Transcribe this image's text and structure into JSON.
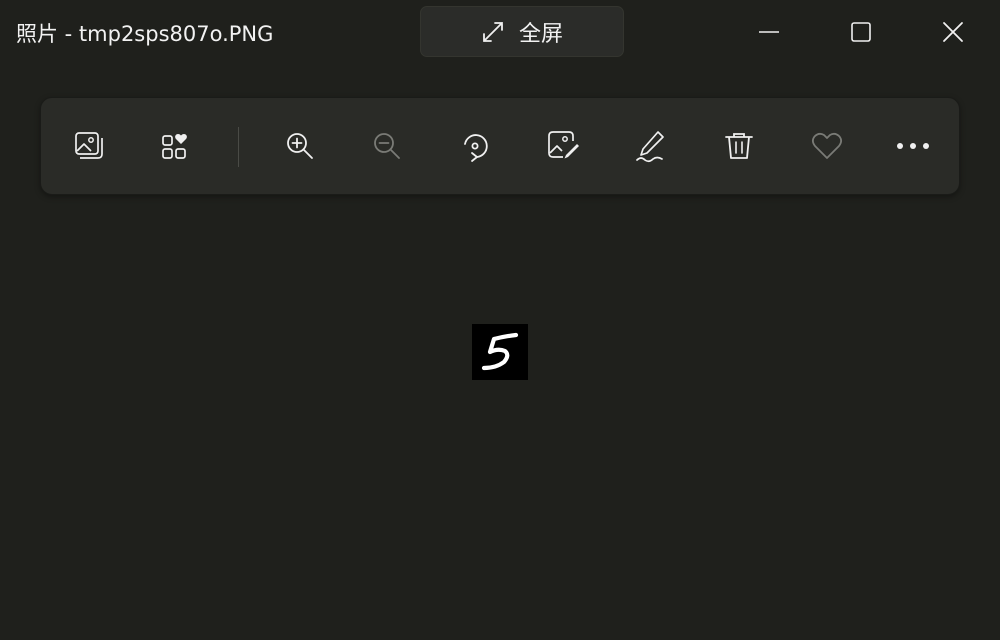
{
  "window": {
    "title": "照片 - tmp2sps807o.PNG"
  },
  "titlebar": {
    "fullscreen_label": "全屏",
    "fullscreen_icon": "expand-diagonal-icon",
    "controls": {
      "minimize_icon": "minimize-icon",
      "maximize_icon": "maximize-icon",
      "close_icon": "close-icon"
    }
  },
  "toolbar": {
    "buttons": [
      {
        "name": "gallery-button",
        "icon": "image-gallery-icon",
        "enabled": true
      },
      {
        "name": "collection-favorites-button",
        "icon": "grid-heart-icon",
        "enabled": true
      },
      {
        "name": "zoom-in-button",
        "icon": "zoom-in-icon",
        "enabled": true
      },
      {
        "name": "zoom-out-button",
        "icon": "zoom-out-icon",
        "enabled": false
      },
      {
        "name": "rotate-button",
        "icon": "rotate-icon",
        "enabled": true
      },
      {
        "name": "edit-image-button",
        "icon": "edit-image-icon",
        "enabled": true
      },
      {
        "name": "markup-button",
        "icon": "pen-draw-icon",
        "enabled": true
      },
      {
        "name": "delete-button",
        "icon": "trash-icon",
        "enabled": true
      },
      {
        "name": "favorite-button",
        "icon": "heart-outline-icon",
        "enabled": false
      },
      {
        "name": "more-options-button",
        "icon": "more-dots-icon",
        "enabled": true
      }
    ]
  },
  "image": {
    "content": "handwritten digit 5, white on black"
  },
  "colors": {
    "background": "#1f201c",
    "toolbar": "#2a2b27",
    "icon": "#f0f0f0",
    "icon_disabled": "#7a7b76"
  }
}
